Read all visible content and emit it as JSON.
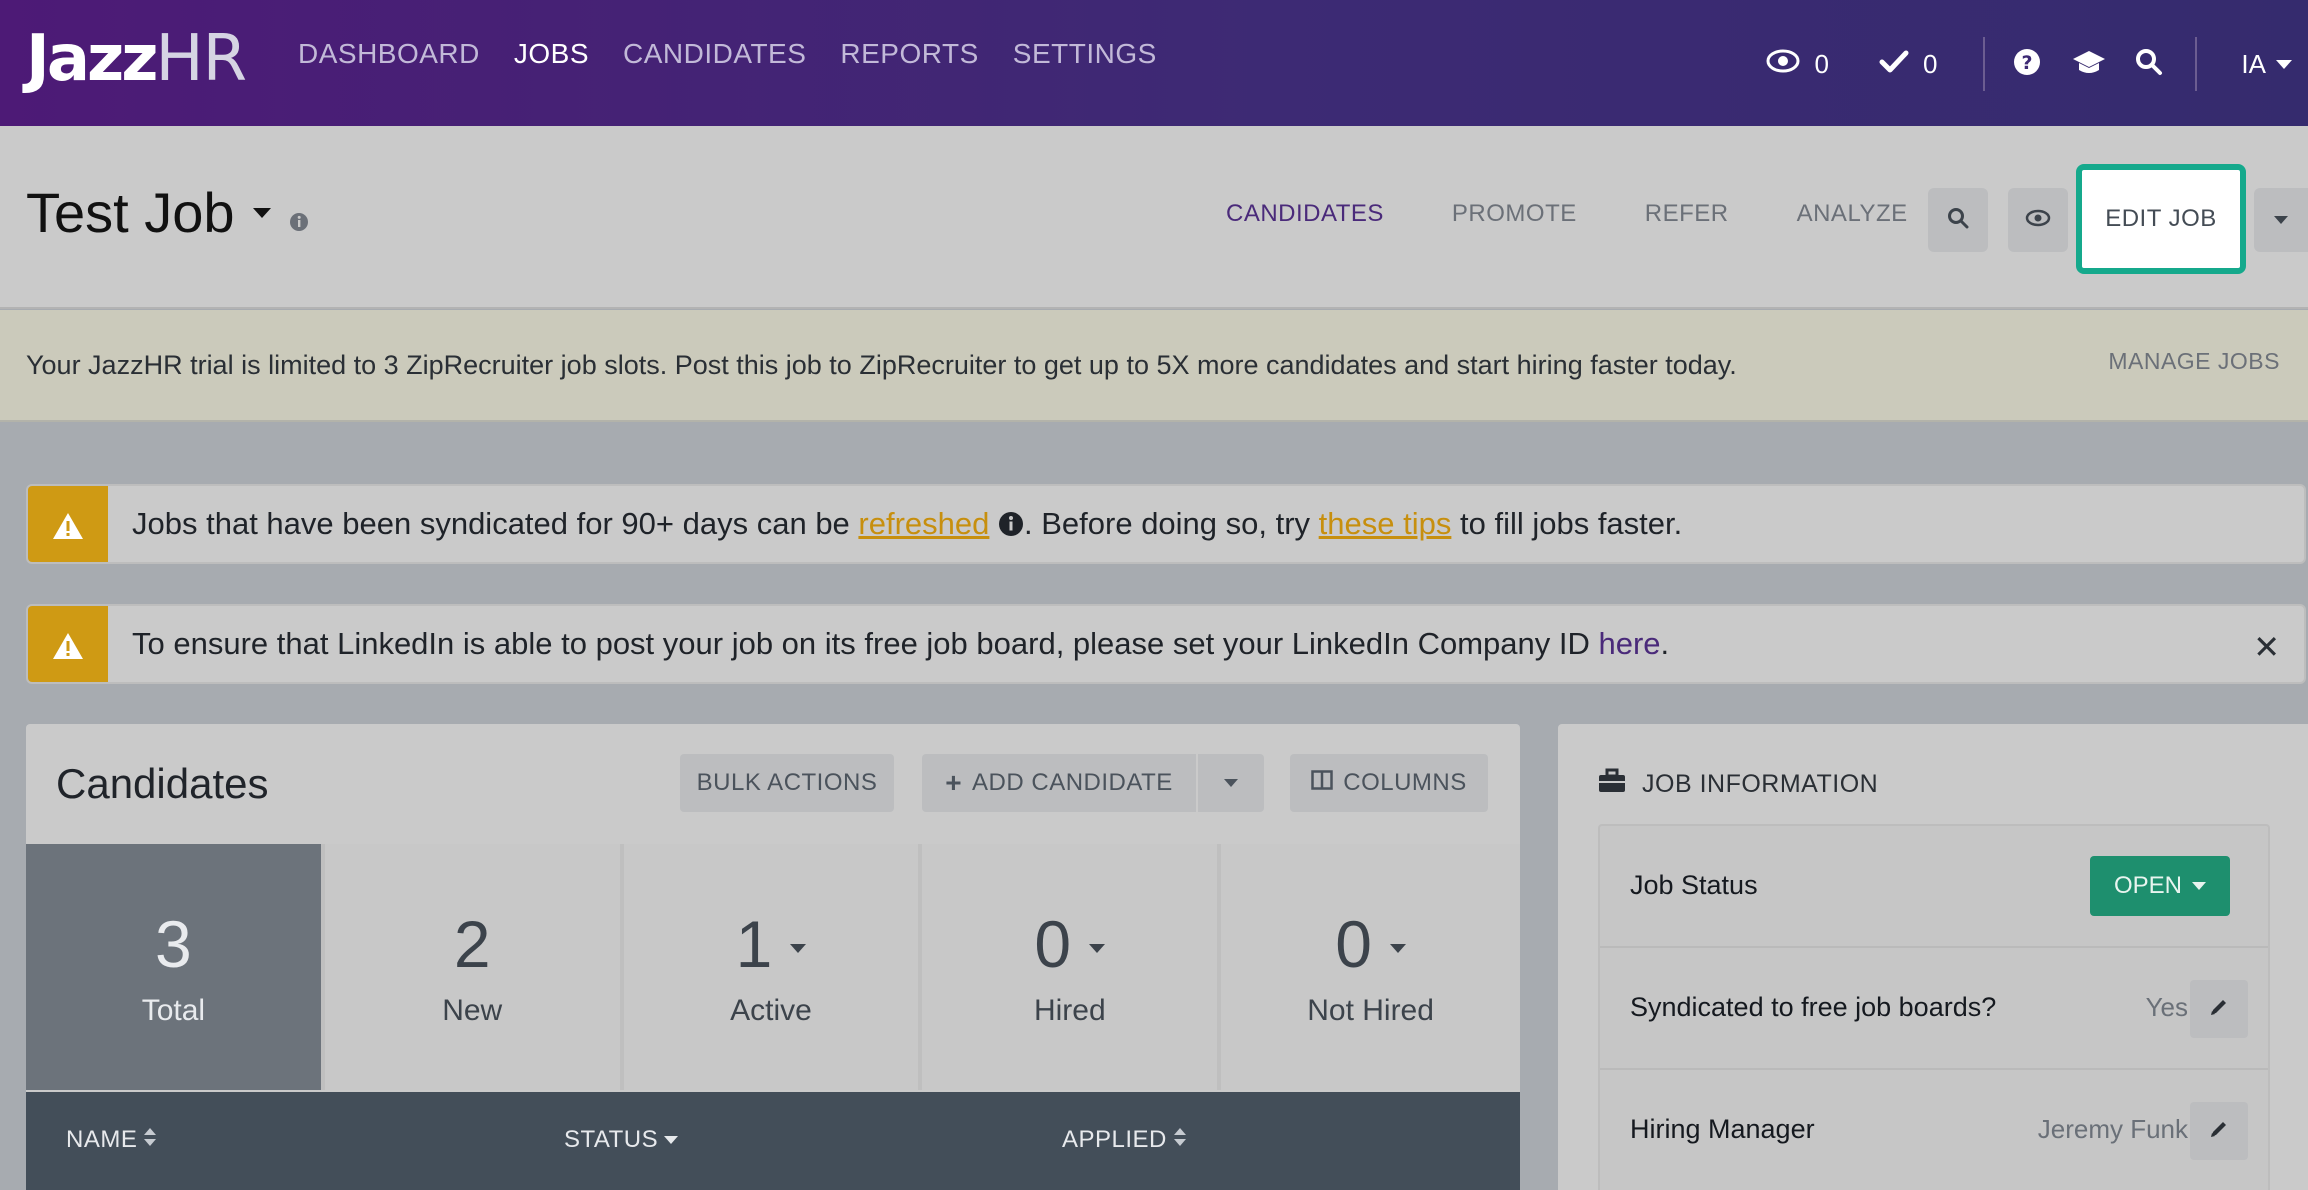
{
  "nav": {
    "logo_jazz": "Jazz",
    "logo_hr": "HR",
    "links": [
      "DASHBOARD",
      "JOBS",
      "CANDIDATES",
      "REPORTS",
      "SETTINGS"
    ],
    "active_link": "JOBS",
    "views_count": "0",
    "tasks_count": "0",
    "user_initials": "IA"
  },
  "header": {
    "job_title": "Test Job",
    "tabs": [
      "CANDIDATES",
      "PROMOTE",
      "REFER",
      "ANALYZE"
    ],
    "edit_job_label": "EDIT JOB"
  },
  "trial_banner": {
    "message": "Your JazzHR trial is limited to 3 ZipRecruiter job slots. Post this job to ZipRecruiter to get up to 5X more candidates and start hiring faster today.",
    "manage_label": "MANAGE JOBS"
  },
  "alerts": {
    "syndicated": {
      "before": "Jobs that have been syndicated for 90+ days can be ",
      "link1": "refreshed",
      "middle": ". Before doing so, try ",
      "link2": "these tips",
      "after": " to fill jobs faster."
    },
    "linkedin": {
      "before": "To ensure that LinkedIn is able to post your job on its free job board, please set your LinkedIn Company ID ",
      "link": "here",
      "after": "."
    }
  },
  "candidates": {
    "title": "Candidates",
    "bulk_actions": "BULK ACTIONS",
    "add_candidate": "ADD CANDIDATE",
    "columns": "COLUMNS",
    "stats": [
      {
        "num": "3",
        "label": "Total"
      },
      {
        "num": "2",
        "label": "New"
      },
      {
        "num": "1",
        "label": "Active"
      },
      {
        "num": "0",
        "label": "Hired"
      },
      {
        "num": "0",
        "label": "Not Hired"
      }
    ],
    "table_headers": {
      "name": "NAME",
      "status": "STATUS",
      "applied": "APPLIED"
    }
  },
  "job_info": {
    "heading": "JOB INFORMATION",
    "job_status_label": "Job Status",
    "job_status_value": "OPEN",
    "syndicated_label": "Syndicated to free job boards?",
    "syndicated_value": "Yes",
    "hiring_manager_label": "Hiring Manager",
    "hiring_manager_value": "Jeremy Funk"
  },
  "colors": {
    "nav_bg": "#4d1a76",
    "accent_green": "#1e8f6e",
    "highlight_teal": "#15a98c",
    "warning_amber": "#cf9a14"
  }
}
